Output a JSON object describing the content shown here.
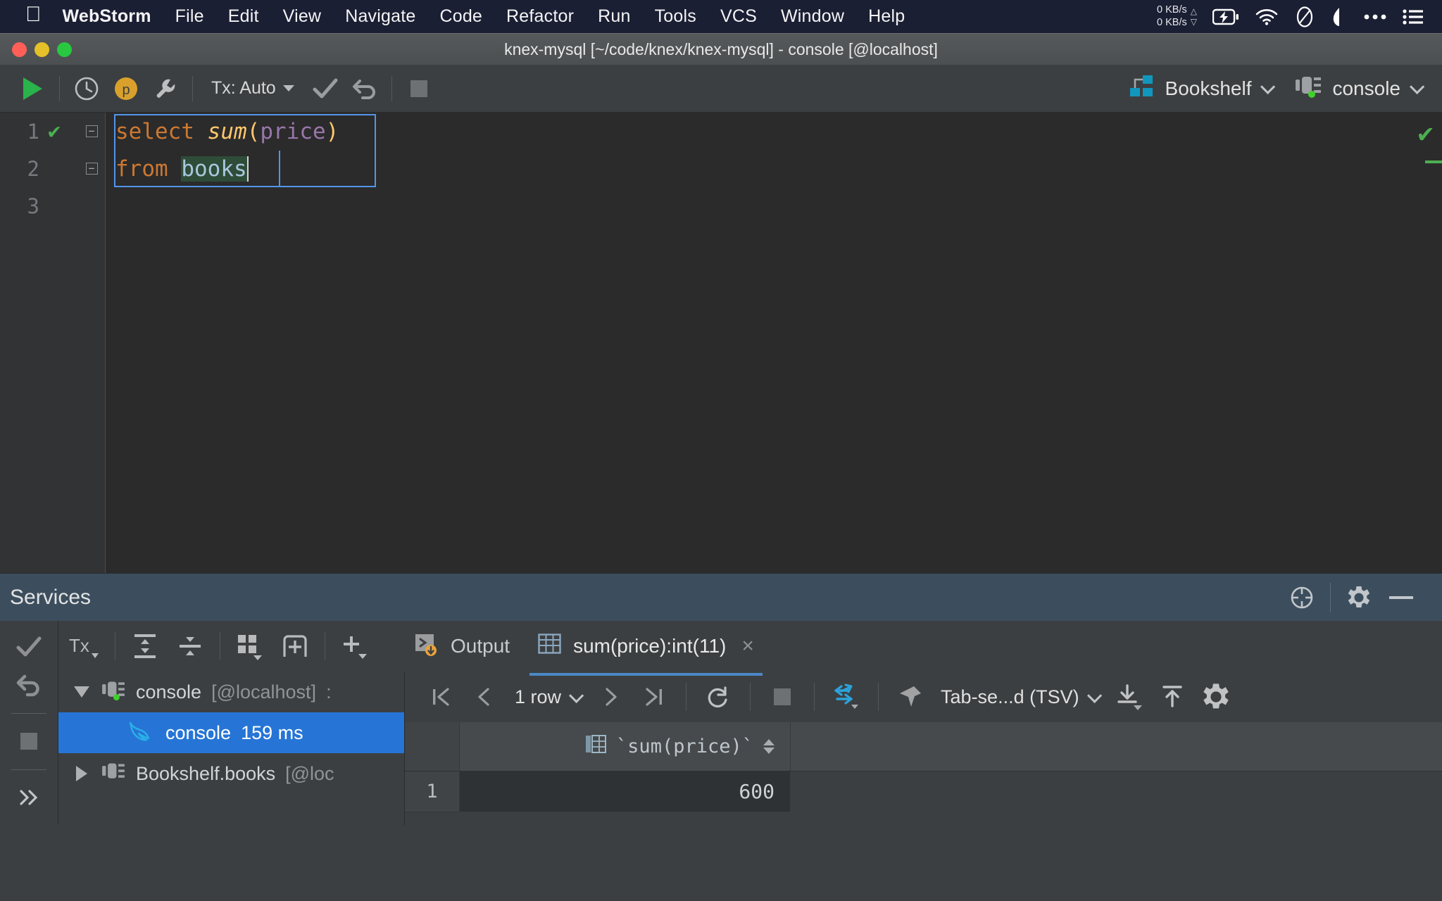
{
  "menubar": {
    "apple_icon": "apple-logo",
    "app_name": "WebStorm",
    "items": [
      "File",
      "Edit",
      "View",
      "Navigate",
      "Code",
      "Refactor",
      "Run",
      "Tools",
      "VCS",
      "Window",
      "Help"
    ],
    "status": {
      "net_up": "0 KB/s",
      "net_down": "0 KB/s",
      "icons": [
        "battery-charging-icon",
        "wifi-icon",
        "do-not-disturb-icon",
        "shape-icon",
        "ellipsis-icon",
        "control-center-icon"
      ]
    }
  },
  "window": {
    "title": "knex-mysql [~/code/knex/knex-mysql] - console [@localhost]",
    "traffic_lights": [
      "close-button",
      "minimize-button",
      "zoom-button"
    ]
  },
  "toolbar": {
    "run_icon": "run-play-icon",
    "history_icon": "history-clock-icon",
    "profile_badge": "p",
    "settings_icon": "wrench-icon",
    "tx_label": "Tx: Auto",
    "commit_icon": "commit-check-icon",
    "rollback_icon": "rollback-arrow-icon",
    "stop_icon": "stop-square-icon",
    "schema_label": "Bookshelf",
    "schema_icon": "database-schema-icon",
    "session_label": "console",
    "session_icon": "console-session-icon"
  },
  "editor": {
    "lines": [
      {
        "num": "1",
        "has_check": true,
        "has_fold": true
      },
      {
        "num": "2",
        "has_check": false,
        "has_fold": true
      },
      {
        "num": "3",
        "has_check": false,
        "has_fold": false
      }
    ],
    "code": {
      "line1": {
        "kw": "select",
        "fn": "sum",
        "open": "(",
        "col": "price",
        "close": ")"
      },
      "line2": {
        "kw": "from",
        "table": "books"
      }
    },
    "inspection_ok_icon": "inspection-ok-check-icon"
  },
  "services": {
    "title": "Services",
    "header_icons": [
      "add-service-icon",
      "settings-gear-icon",
      "hide-panel-icon"
    ],
    "left_rail_icons": [
      "commit-check-icon",
      "rollback-arrow-icon",
      "stop-square-icon",
      "expand-chevrons-icon"
    ],
    "toolbar_icons": [
      "tx-dropdown-icon",
      "expand-all-icon",
      "collapse-all-icon",
      "group-by-icon",
      "add-frame-icon",
      "add-dropdown-icon"
    ],
    "tx_label": "Tx",
    "tabs": [
      {
        "label": "Output",
        "icon": "output-console-icon",
        "active": false,
        "closable": false
      },
      {
        "label": "sum(price):int(11)",
        "icon": "result-table-icon",
        "active": true,
        "closable": true,
        "close_label": "×"
      }
    ],
    "tree": [
      {
        "label": "console",
        "suffix": "[@localhost]",
        "trailing": ":",
        "icon": "console-session-icon",
        "expanded": true,
        "selected": false,
        "indent": 0
      },
      {
        "label": "console",
        "duration": "159 ms",
        "icon": "mysql-dolphin-icon",
        "selected": true,
        "indent": 1
      },
      {
        "label": "Bookshelf.books",
        "suffix": "[@loc",
        "icon": "console-session-icon",
        "expanded": false,
        "selected": false,
        "indent": 0
      }
    ],
    "result_toolbar": {
      "first_icon": "first-page-icon",
      "prev_icon": "prev-page-icon",
      "row_count_label": "1 row",
      "next_icon": "next-page-icon",
      "last_icon": "last-page-icon",
      "refresh_icon": "refresh-icon",
      "stop_icon": "stop-square-icon",
      "transpose_icon": "transpose-arrows-icon",
      "pin_icon": "pin-icon",
      "format_label": "Tab-se...d (TSV)",
      "export_icon": "export-download-icon",
      "import_icon": "import-upload-icon",
      "settings_icon": "settings-gear-icon"
    },
    "grid": {
      "columns": [
        "`sum(price)`"
      ],
      "column_icon": "column-icon",
      "rows": [
        {
          "num": "1",
          "values": [
            "600"
          ]
        }
      ]
    }
  },
  "colors": {
    "menubar_bg": "#1B1F33",
    "titlebar_bg": "#4C4F51",
    "ide_bg": "#3C3F41",
    "editor_bg": "#2B2B2B",
    "services_header_bg": "#3C4E5E",
    "selection_blue": "#2675D6",
    "accent_teal": "#1E9FC4",
    "keyword_orange": "#CC7832",
    "function_yellow": "#FFC66D",
    "column_purple": "#9876AA",
    "table_blue": "#A9C7DC",
    "success_green": "#4CAF50"
  }
}
